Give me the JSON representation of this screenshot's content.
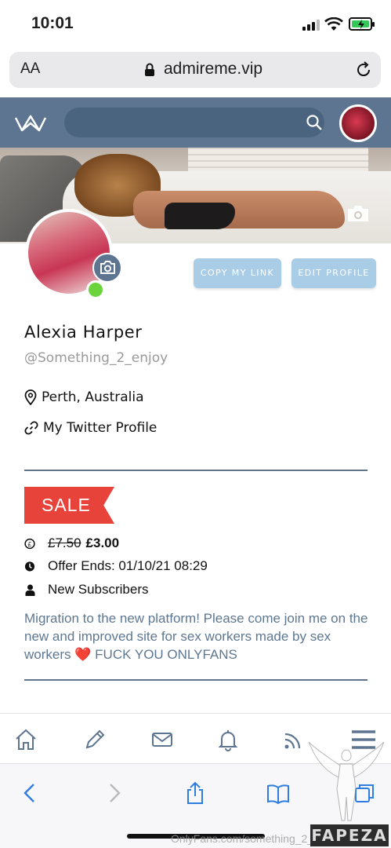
{
  "status_bar": {
    "time": "10:01"
  },
  "browser": {
    "text_size_label": "AA",
    "url": "admireme.vip"
  },
  "profile": {
    "name": "Alexia Harper",
    "handle": "@Something_2_enjoy",
    "location": "Perth, Australia",
    "link_label": "My Twitter Profile",
    "buttons": {
      "copy_link": "COPY MY LINK",
      "edit_profile": "EDIT PROFILE"
    },
    "online": true
  },
  "promo": {
    "badge": "SALE",
    "old_price": "£7.50",
    "new_price": "£3.00",
    "offer_ends": "Offer Ends: 01/10/21 08:29",
    "audience": "New Subscribers",
    "message_part1": "Migration to the new platform! Please come join me on the new and improved site for sex workers made by sex workers",
    "message_emoji": "❤️",
    "message_part2": "FUCK YOU ONLYFANS"
  },
  "site_nav": {
    "items": [
      "home-icon",
      "pencil-icon",
      "mail-icon",
      "bell-icon",
      "feed-icon",
      "menu-icon"
    ]
  },
  "safari_toolbar": {
    "items": [
      "back-icon",
      "forward-icon",
      "share-icon",
      "bookmarks-icon",
      "tabs-icon"
    ]
  },
  "watermark": {
    "text": "OnlyFans.com/something_2_enjoy",
    "brand": "FAPEZA"
  },
  "colors": {
    "header": "#5d7590",
    "button": "#a9cde6",
    "sale": "#e8433a",
    "bio": "#5e7791",
    "online": "#6bd43d"
  }
}
